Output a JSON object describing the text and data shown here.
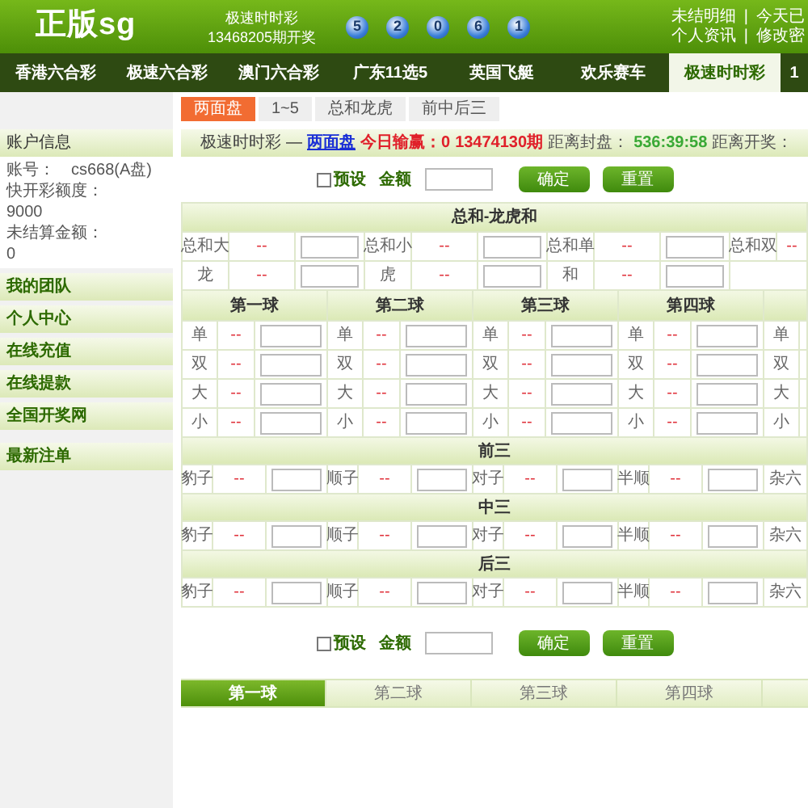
{
  "header": {
    "logo": "正版sg",
    "game": "极速时时彩",
    "period": "13468205期开奖",
    "balls": [
      "5",
      "2",
      "0",
      "6",
      "1"
    ],
    "user_links": [
      {
        "left": "未结明细",
        "separator": "|",
        "right": "今天已"
      },
      {
        "left": "个人资讯",
        "separator": "|",
        "right": "修改密"
      }
    ]
  },
  "nav": [
    {
      "label": "香港六合彩",
      "selected": false
    },
    {
      "label": "极速六合彩",
      "selected": false
    },
    {
      "label": "澳门六合彩",
      "selected": false
    },
    {
      "label": "广东11选5",
      "selected": false
    },
    {
      "label": "英国飞艇",
      "selected": false
    },
    {
      "label": "欢乐赛车",
      "selected": false
    },
    {
      "label": "极速时时彩",
      "selected": true
    },
    {
      "label": "1",
      "selected": false
    }
  ],
  "subtabs": [
    {
      "label": "两面盘",
      "selected": true
    },
    {
      "label": "1~5",
      "selected": false
    },
    {
      "label": "总和龙虎",
      "selected": false
    },
    {
      "label": "前中后三",
      "selected": false
    }
  ],
  "sidebar": {
    "account_title": "账户信息",
    "account": [
      {
        "label": "账号：",
        "value": "cs668(A盘)"
      },
      {
        "label": "快开彩额度：",
        "value": "9000"
      },
      {
        "label": "未结算金额：",
        "value": "0"
      }
    ],
    "menu": [
      "我的团队",
      "个人中心",
      "在线充值",
      "在线提款",
      "全国开奖网"
    ],
    "latest": "最新注单"
  },
  "info": {
    "game": "极速时时彩",
    "separator": "—",
    "mode": "两面盘",
    "profit_label": "今日输赢：",
    "profit": "0",
    "period": "13474130期",
    "close_label": "距离封盘：",
    "close_time": "536:39:58",
    "open_label": "距离开奖："
  },
  "bet_controls": [
    {
      "preset_label": "预设",
      "preset_checked": false,
      "amount_label": "金额",
      "confirm": "确定",
      "reset": "重置"
    },
    {
      "preset_label": "预设",
      "preset_checked": false,
      "amount_label": "金额",
      "confirm": "确定",
      "reset": "重置"
    }
  ],
  "sum_table": {
    "title": "总和-龙虎和",
    "rows": [
      [
        {
          "label": "总和大",
          "odds": "--"
        },
        {
          "label": "总和小",
          "odds": "--"
        },
        {
          "label": "总和单",
          "odds": "--"
        },
        {
          "label": "总和双",
          "odds": "--"
        }
      ],
      [
        {
          "label": "龙",
          "odds": "--"
        },
        {
          "label": "虎",
          "odds": "--"
        },
        {
          "label": "和",
          "odds": "--"
        }
      ]
    ]
  },
  "ball_columns": [
    {
      "title": "第一球",
      "rows": [
        {
          "label": "单",
          "odds": "--"
        },
        {
          "label": "双",
          "odds": "--"
        },
        {
          "label": "大",
          "odds": "--"
        },
        {
          "label": "小",
          "odds": "--"
        }
      ]
    },
    {
      "title": "第二球",
      "rows": [
        {
          "label": "单",
          "odds": "--"
        },
        {
          "label": "双",
          "odds": "--"
        },
        {
          "label": "大",
          "odds": "--"
        },
        {
          "label": "小",
          "odds": "--"
        }
      ]
    },
    {
      "title": "第三球",
      "rows": [
        {
          "label": "单",
          "odds": "--"
        },
        {
          "label": "双",
          "odds": "--"
        },
        {
          "label": "大",
          "odds": "--"
        },
        {
          "label": "小",
          "odds": "--"
        }
      ]
    },
    {
      "title": "第四球",
      "rows": [
        {
          "label": "单",
          "odds": "--"
        },
        {
          "label": "双",
          "odds": "--"
        },
        {
          "label": "大",
          "odds": "--"
        },
        {
          "label": "小",
          "odds": "--"
        }
      ]
    },
    {
      "rows": [
        {
          "label": "单"
        },
        {
          "label": "双"
        },
        {
          "label": "大"
        },
        {
          "label": "小"
        }
      ]
    }
  ],
  "groups": [
    {
      "title": "前三",
      "items": [
        {
          "label": "豹子",
          "odds": "--"
        },
        {
          "label": "顺子",
          "odds": "--"
        },
        {
          "label": "对子",
          "odds": "--"
        },
        {
          "label": "半顺",
          "odds": "--"
        },
        {
          "label": "杂六"
        }
      ]
    },
    {
      "title": "中三",
      "items": [
        {
          "label": "豹子",
          "odds": "--"
        },
        {
          "label": "顺子",
          "odds": "--"
        },
        {
          "label": "对子",
          "odds": "--"
        },
        {
          "label": "半顺",
          "odds": "--"
        },
        {
          "label": "杂六"
        }
      ]
    },
    {
      "title": "后三",
      "items": [
        {
          "label": "豹子",
          "odds": "--"
        },
        {
          "label": "顺子",
          "odds": "--"
        },
        {
          "label": "对子",
          "odds": "--"
        },
        {
          "label": "半顺",
          "odds": "--"
        },
        {
          "label": "杂六"
        }
      ]
    }
  ],
  "ball_tabs": [
    {
      "label": "第一球",
      "selected": true
    },
    {
      "label": "第二球",
      "selected": false
    },
    {
      "label": "第三球",
      "selected": false
    },
    {
      "label": "第四球",
      "selected": false
    }
  ]
}
